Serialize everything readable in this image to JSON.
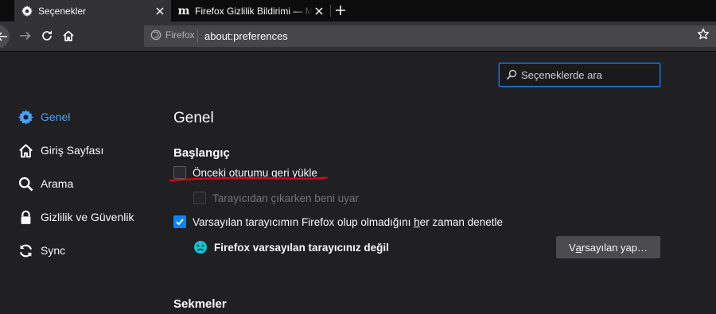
{
  "tabs": [
    {
      "title": "Seçenekler",
      "icon": "gear-icon",
      "active": true
    },
    {
      "title": "Firefox Gizlilik Bildirimi — Mozilla",
      "icon": "mozilla-m-icon",
      "favicon_text": "m",
      "active": false
    }
  ],
  "navbar": {
    "identity_label": "Firefox",
    "url": "about:preferences"
  },
  "search": {
    "placeholder": "Seçeneklerde ara"
  },
  "sidebar": {
    "items": [
      {
        "label": "Genel",
        "icon": "gear-icon",
        "selected": true
      },
      {
        "label": "Giriş Sayfası",
        "icon": "home-icon",
        "selected": false
      },
      {
        "label": "Arama",
        "icon": "search-icon",
        "selected": false
      },
      {
        "label": "Gizlilik ve Güvenlik",
        "icon": "lock-icon",
        "selected": false
      },
      {
        "label": "Sync",
        "icon": "sync-icon",
        "selected": false
      }
    ]
  },
  "content": {
    "title": "Genel",
    "startup_heading": "Başlangıç",
    "restore_session": {
      "label_pre": "Önceki ",
      "label_ul": "o",
      "label_post": "turumu geri yükle",
      "checked": false
    },
    "warn_on_quit": {
      "label": "Tarayıcıdan çıkarken beni uyar",
      "checked": false,
      "disabled": true
    },
    "check_default": {
      "label_pre": "Varsayılan tarayıcımın Firefox olup olmadığını ",
      "label_ul": "h",
      "label_post": "er zaman denetle",
      "checked": true
    },
    "not_default_message": "Firefox varsayılan tarayıcınız değil",
    "set_default_button": {
      "pre": "V",
      "ul": "a",
      "post": "rsayılan yap…"
    },
    "tabs_heading": "Sekmeler"
  },
  "colors": {
    "accent": "#0a84ff",
    "selected_text": "#45a1ff",
    "annotation_red": "#e0001a",
    "sad_face": "#00c8d7"
  }
}
